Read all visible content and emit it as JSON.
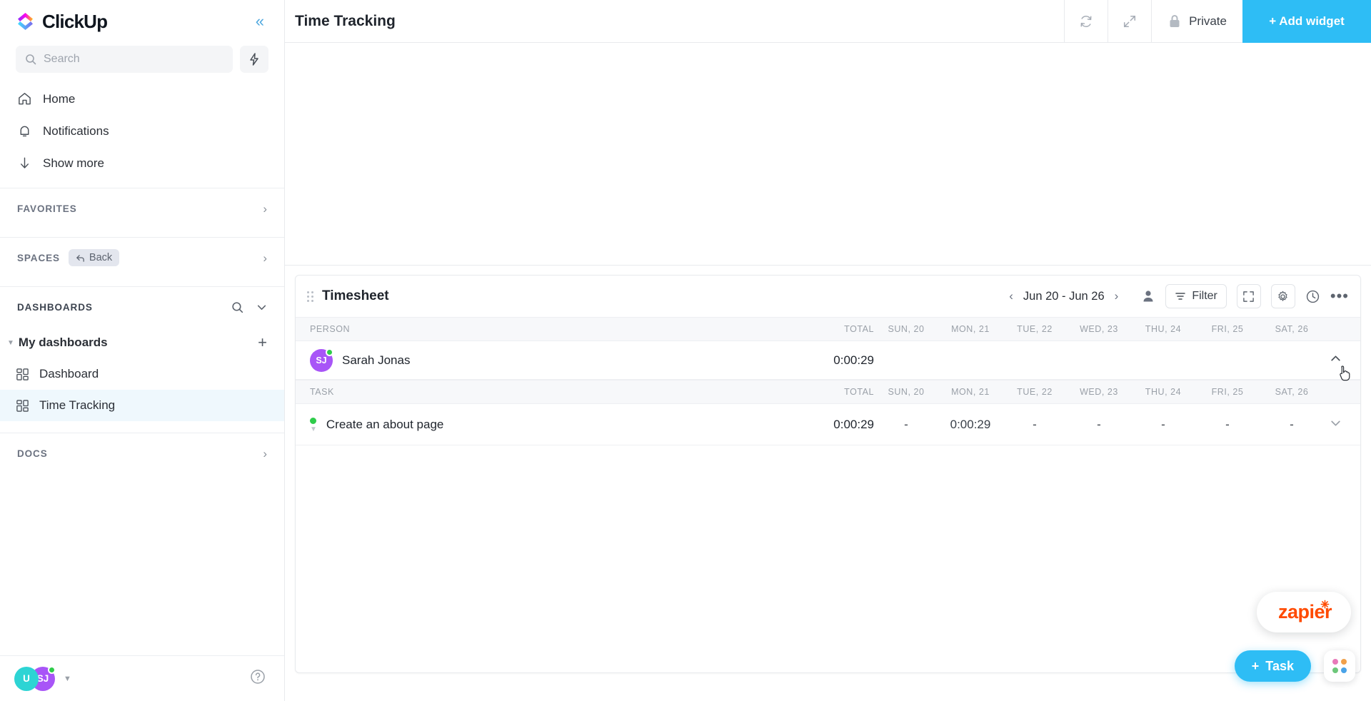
{
  "sidebar": {
    "brand": "ClickUp",
    "search": {
      "placeholder": "Search",
      "icon": "search-icon"
    },
    "bolt_icon": "lightning-bolt-icon",
    "collapse_icon": "double-chevron-left-icon",
    "nav": [
      {
        "label": "Home",
        "icon": "home-icon"
      },
      {
        "label": "Notifications",
        "icon": "bell-icon"
      },
      {
        "label": "Show more",
        "icon": "arrow-down-icon"
      }
    ],
    "sections": {
      "favorites": "FAVORITES",
      "spaces": "SPACES",
      "spaces_back": "Back",
      "dashboards": "DASHBOARDS",
      "docs": "DOCS"
    },
    "my_dashboards": {
      "label": "My dashboards",
      "add_label": "+",
      "items": [
        {
          "label": "Dashboard",
          "icon": "dashboard-grid-icon",
          "active": false
        },
        {
          "label": "Time Tracking",
          "icon": "dashboard-grid-icon",
          "active": true
        }
      ]
    },
    "footer": {
      "avatar_1": "U",
      "avatar_2": "SJ",
      "help_label": "?"
    }
  },
  "header": {
    "title": "Time Tracking",
    "refresh_icon": "refresh-icon",
    "expand_icon": "expand-arrows-icon",
    "privacy_label": "Private",
    "lock_icon": "lock-icon",
    "add_widget_label": "+ Add widget"
  },
  "widget": {
    "title": "Timesheet",
    "grip_icon": "drag-grip-icon",
    "date_range": "Jun 20 - Jun 26",
    "prev_icon": "chevron-left-icon",
    "next_icon": "chevron-right-icon",
    "person_icon": "person-icon",
    "filter_label": "Filter",
    "filter_icon": "filter-lines-icon",
    "fullscreen_icon": "fullscreen-icon",
    "settings_icon": "gear-icon",
    "clock_icon": "clock-icon",
    "more_icon": "ellipsis-icon",
    "person_table": {
      "headers": [
        "PERSON",
        "TOTAL",
        "SUN, 20",
        "MON, 21",
        "TUE, 22",
        "WED, 23",
        "THU, 24",
        "FRI, 25",
        "SAT, 26"
      ],
      "rows": [
        {
          "initials": "SJ",
          "name": "Sarah Jonas",
          "total": "0:00:29",
          "days": [
            "",
            "",
            "",
            "",
            "",
            "",
            ""
          ],
          "collapse_icon": "chevron-up-icon",
          "online": true
        }
      ]
    },
    "task_table": {
      "headers": [
        "TASK",
        "TOTAL",
        "SUN, 20",
        "MON, 21",
        "TUE, 22",
        "WED, 23",
        "THU, 24",
        "FRI, 25",
        "SAT, 26"
      ],
      "rows": [
        {
          "name": "Create an about page",
          "status_color": "#2ecc4a",
          "total": "0:00:29",
          "days": [
            "-",
            "0:00:29",
            "-",
            "-",
            "-",
            "-",
            "-"
          ],
          "expand_icon": "chevron-down-icon"
        }
      ]
    }
  },
  "floating": {
    "zapier_label": "zapier",
    "task_button_label": "Task",
    "task_plus": "+",
    "apps_icon": "apps-grid-icon"
  },
  "colors": {
    "accent": "#2ebdf5",
    "avatar_purple": "#a855f7",
    "avatar_teal": "#2dd4d4",
    "status_green": "#2ecc4a",
    "zapier_orange": "#ff4a00",
    "active_item_bg": "#eff8fd"
  }
}
